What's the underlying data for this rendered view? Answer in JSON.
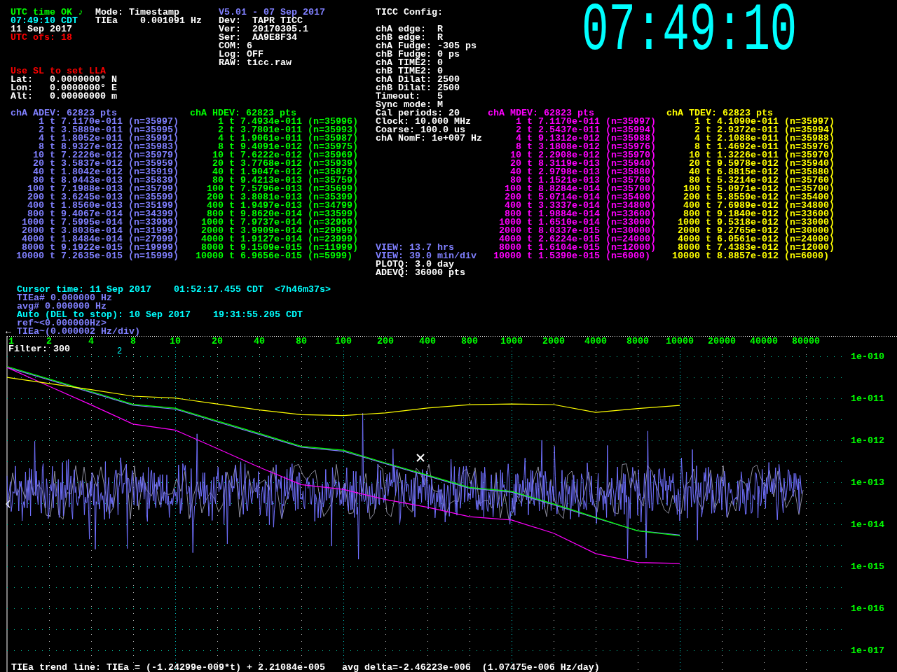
{
  "status": [
    {
      "text": "UTC time OK ♪",
      "color": "#00ff00"
    },
    {
      "text": "07:49:10 CDT",
      "color": "#00ffff"
    },
    {
      "text": "11 Sep 2017",
      "color": "#ffffff"
    },
    {
      "text": "UTC ofs: 18",
      "color": "#ff0000"
    }
  ],
  "location": [
    {
      "text": "Use SL to set LLA",
      "color": "#ff0000"
    },
    {
      "text": "Lat:   0.0000000° N",
      "color": "#ffffff"
    },
    {
      "text": "Lon:   0.0000000° E",
      "color": "#ffffff"
    },
    {
      "text": "Alt:   0.00000000 m",
      "color": "#ffffff"
    }
  ],
  "mode": [
    "Mode: Timestamp",
    "TIEa    0.001091 Hz"
  ],
  "device": [
    {
      "text": "V5.01 - 07 Sep 2017",
      "color": "#8080ff"
    },
    {
      "text": "Dev:  TAPR TICC",
      "color": "#ffffff"
    },
    {
      "text": "Ver:  20170305.1",
      "color": "#ffffff"
    },
    {
      "text": "Ser:  AA9E8F34",
      "color": "#ffffff"
    },
    {
      "text": "COM: 6",
      "color": "#ffffff"
    },
    {
      "text": "Log: OFF",
      "color": "#ffffff"
    },
    {
      "text": "RAW: ticc.raw",
      "color": "#ffffff"
    }
  ],
  "config": {
    "title": "TICC Config:",
    "lines": [
      "chA edge:  R",
      "chB edge:  R",
      "chA Fudge: -305 ps",
      "chB Fudge: 0 ps",
      "chA TIME2: 0",
      "chB TIME2: 0",
      "chA Dilat: 2500",
      "chB Dilat: 2500",
      "Timeout:   5",
      "Sync mode: M",
      "Cal periods: 20",
      "Clock: 10.000 MHz",
      "Coarse: 100.0 us",
      "chA NomF: 1e+007 Hz"
    ]
  },
  "view": [
    {
      "text": "VIEW: 13.7 hrs",
      "color": "#8080ff"
    },
    {
      "text": "VIEW: 39.0 min/div",
      "color": "#8080ff"
    },
    {
      "text": "PLOTQ: 3.0 day",
      "color": "#ffffff"
    },
    {
      "text": "ADEVQ: 36000 pts",
      "color": "#ffffff"
    }
  ],
  "clock": "07:49:10",
  "tables": [
    {
      "title": "chA ADEV: 62823 pts",
      "color": "#8080ff",
      "rows": [
        {
          "tau": "1",
          "symbol": "t",
          "dev": "7.1170e-011",
          "n": "(n=35997)"
        },
        {
          "tau": "2",
          "symbol": "t",
          "dev": "3.5889e-011",
          "n": "(n=35995)"
        },
        {
          "tau": "4",
          "symbol": "t",
          "dev": "1.8052e-011",
          "n": "(n=35991)"
        },
        {
          "tau": "8",
          "symbol": "t",
          "dev": "8.9327e-012",
          "n": "(n=35983)"
        },
        {
          "tau": "10",
          "symbol": "t",
          "dev": "7.2226e-012",
          "n": "(n=35979)"
        },
        {
          "tau": "20",
          "symbol": "t",
          "dev": "3.5837e-012",
          "n": "(n=35959)"
        },
        {
          "tau": "40",
          "symbol": "t",
          "dev": "1.8042e-012",
          "n": "(n=35919)"
        },
        {
          "tau": "80",
          "symbol": "t",
          "dev": "8.9443e-013",
          "n": "(n=35839)"
        },
        {
          "tau": "100",
          "symbol": "t",
          "dev": "7.1988e-013",
          "n": "(n=35799)"
        },
        {
          "tau": "200",
          "symbol": "t",
          "dev": "3.6245e-013",
          "n": "(n=35599)"
        },
        {
          "tau": "400",
          "symbol": "t",
          "dev": "1.8560e-013",
          "n": "(n=35199)"
        },
        {
          "tau": "800",
          "symbol": "t",
          "dev": "9.4067e-014",
          "n": "(n=34399)"
        },
        {
          "tau": "1000",
          "symbol": "t",
          "dev": "7.5995e-014",
          "n": "(n=33999)"
        },
        {
          "tau": "2000",
          "symbol": "t",
          "dev": "3.8036e-014",
          "n": "(n=31999)"
        },
        {
          "tau": "4000",
          "symbol": "t",
          "dev": "1.8484e-014",
          "n": "(n=27999)"
        },
        {
          "tau": "8000",
          "symbol": "t",
          "dev": "9.1922e-015",
          "n": "(n=19999)"
        },
        {
          "tau": "10000",
          "symbol": "t",
          "dev": "7.2635e-015",
          "n": "(n=15999)"
        }
      ]
    },
    {
      "title": "chA HDEV: 62823 pts",
      "color": "#00ff00",
      "rows": [
        {
          "tau": "1",
          "symbol": "t",
          "dev": "7.4934e-011",
          "n": "(n=35996)"
        },
        {
          "tau": "2",
          "symbol": "t",
          "dev": "3.7801e-011",
          "n": "(n=35993)"
        },
        {
          "tau": "4",
          "symbol": "t",
          "dev": "1.9061e-011",
          "n": "(n=35987)"
        },
        {
          "tau": "8",
          "symbol": "t",
          "dev": "9.4091e-012",
          "n": "(n=35975)"
        },
        {
          "tau": "10",
          "symbol": "t",
          "dev": "7.6222e-012",
          "n": "(n=35969)"
        },
        {
          "tau": "20",
          "symbol": "t",
          "dev": "3.7768e-012",
          "n": "(n=35939)"
        },
        {
          "tau": "40",
          "symbol": "t",
          "dev": "1.9047e-012",
          "n": "(n=35879)"
        },
        {
          "tau": "80",
          "symbol": "t",
          "dev": "9.4213e-013",
          "n": "(n=35759)"
        },
        {
          "tau": "100",
          "symbol": "t",
          "dev": "7.5796e-013",
          "n": "(n=35699)"
        },
        {
          "tau": "200",
          "symbol": "t",
          "dev": "3.8081e-013",
          "n": "(n=35399)"
        },
        {
          "tau": "400",
          "symbol": "t",
          "dev": "1.9497e-013",
          "n": "(n=34799)"
        },
        {
          "tau": "800",
          "symbol": "t",
          "dev": "9.8620e-014",
          "n": "(n=33599)"
        },
        {
          "tau": "1000",
          "symbol": "t",
          "dev": "7.9737e-014",
          "n": "(n=32999)"
        },
        {
          "tau": "2000",
          "symbol": "t",
          "dev": "3.9909e-014",
          "n": "(n=29999)"
        },
        {
          "tau": "4000",
          "symbol": "t",
          "dev": "1.9127e-014",
          "n": "(n=23999)"
        },
        {
          "tau": "8000",
          "symbol": "t",
          "dev": "9.1509e-015",
          "n": "(n=11999)"
        },
        {
          "tau": "10000",
          "symbol": "t",
          "dev": "6.9656e-015",
          "n": "(n=5999)"
        }
      ]
    },
    {
      "title": "chA MDEV: 62823 pts",
      "color": "#ff00ff",
      "rows": [
        {
          "tau": "1",
          "symbol": "t",
          "dev": "7.1170e-011",
          "n": "(n=35997)"
        },
        {
          "tau": "2",
          "symbol": "t",
          "dev": "2.5437e-011",
          "n": "(n=35994)"
        },
        {
          "tau": "4",
          "symbol": "t",
          "dev": "9.1312e-012",
          "n": "(n=35988)"
        },
        {
          "tau": "8",
          "symbol": "t",
          "dev": "3.1808e-012",
          "n": "(n=35976)"
        },
        {
          "tau": "10",
          "symbol": "t",
          "dev": "2.2908e-012",
          "n": "(n=35970)"
        },
        {
          "tau": "20",
          "symbol": "t",
          "dev": "8.3119e-013",
          "n": "(n=35940)"
        },
        {
          "tau": "40",
          "symbol": "t",
          "dev": "2.9798e-013",
          "n": "(n=35880)"
        },
        {
          "tau": "80",
          "symbol": "t",
          "dev": "1.1521e-013",
          "n": "(n=35760)"
        },
        {
          "tau": "100",
          "symbol": "t",
          "dev": "8.8284e-014",
          "n": "(n=35700)"
        },
        {
          "tau": "200",
          "symbol": "t",
          "dev": "5.0714e-014",
          "n": "(n=35400)"
        },
        {
          "tau": "400",
          "symbol": "t",
          "dev": "3.3337e-014",
          "n": "(n=34800)"
        },
        {
          "tau": "800",
          "symbol": "t",
          "dev": "1.9884e-014",
          "n": "(n=33600)"
        },
        {
          "tau": "1000",
          "symbol": "t",
          "dev": "1.6510e-014",
          "n": "(n=33000)"
        },
        {
          "tau": "2000",
          "symbol": "t",
          "dev": "8.0337e-015",
          "n": "(n=30000)"
        },
        {
          "tau": "4000",
          "symbol": "t",
          "dev": "2.6224e-015",
          "n": "(n=24000)"
        },
        {
          "tau": "8000",
          "symbol": "t",
          "dev": "1.6104e-015",
          "n": "(n=12000)"
        },
        {
          "tau": "10000",
          "symbol": "t",
          "dev": "1.5390e-015",
          "n": "(n=6000)"
        }
      ]
    },
    {
      "title": "chA TDEV: 62823 pts",
      "color": "#ffff00",
      "rows": [
        {
          "tau": "1",
          "symbol": "t",
          "dev": "4.1090e-011",
          "n": "(n=35997)"
        },
        {
          "tau": "2",
          "symbol": "t",
          "dev": "2.9372e-011",
          "n": "(n=35994)"
        },
        {
          "tau": "4",
          "symbol": "t",
          "dev": "2.1088e-011",
          "n": "(n=35988)"
        },
        {
          "tau": "8",
          "symbol": "t",
          "dev": "1.4692e-011",
          "n": "(n=35976)"
        },
        {
          "tau": "10",
          "symbol": "t",
          "dev": "1.3226e-011",
          "n": "(n=35970)"
        },
        {
          "tau": "20",
          "symbol": "t",
          "dev": "9.5978e-012",
          "n": "(n=35940)"
        },
        {
          "tau": "40",
          "symbol": "t",
          "dev": "6.8815e-012",
          "n": "(n=35880)"
        },
        {
          "tau": "80",
          "symbol": "t",
          "dev": "5.3214e-012",
          "n": "(n=35760)"
        },
        {
          "tau": "100",
          "symbol": "t",
          "dev": "5.0971e-012",
          "n": "(n=35700)"
        },
        {
          "tau": "200",
          "symbol": "t",
          "dev": "5.8559e-012",
          "n": "(n=35400)"
        },
        {
          "tau": "400",
          "symbol": "t",
          "dev": "7.6989e-012",
          "n": "(n=34800)"
        },
        {
          "tau": "800",
          "symbol": "t",
          "dev": "9.1840e-012",
          "n": "(n=33600)"
        },
        {
          "tau": "1000",
          "symbol": "t",
          "dev": "9.5318e-012",
          "n": "(n=33000)"
        },
        {
          "tau": "2000",
          "symbol": "t",
          "dev": "9.2765e-012",
          "n": "(n=30000)"
        },
        {
          "tau": "4000",
          "symbol": "t",
          "dev": "6.0561e-012",
          "n": "(n=24000)"
        },
        {
          "tau": "8000",
          "symbol": "t",
          "dev": "7.4383e-012",
          "n": "(n=12000)"
        },
        {
          "tau": "10000",
          "symbol": "t",
          "dev": "8.8857e-012",
          "n": "(n=6000)"
        }
      ]
    }
  ],
  "cursor": {
    "lines": [
      {
        "text": "Cursor time: 11 Sep 2017    01:52:17.455 CDT  <7h46m37s>",
        "color": "#00ffff"
      },
      {
        "text": "TIEa# 0.000000 Hz",
        "color": "#8080ff"
      },
      {
        "text": "avg# 0.000000 Hz",
        "color": "#8080ff"
      },
      {
        "text": "Auto (DEL to stop): 10 Sep 2017    19:31:55.205 CDT",
        "color": "#00ffff"
      },
      {
        "text": "ref~<0.000000Hz>",
        "color": "#8080ff"
      }
    ],
    "arrow": "←",
    "scale": {
      "text": "TIEa~(0.000002 Hz/div)",
      "color": "#8080ff"
    }
  },
  "plot": {
    "tau_labels": [
      "1",
      "2",
      "4",
      "8",
      "10",
      "20",
      "40",
      "80",
      "100",
      "200",
      "400",
      "800",
      "1000",
      "2000",
      "4000",
      "8000",
      "10000",
      "20000",
      "40000",
      "80000"
    ],
    "filter": "Filter: 300",
    "marker_label": "2",
    "decade_labels": [
      "1e-010",
      "1e-011",
      "1e-012",
      "1e-013",
      "1e-014",
      "1e-015",
      "1e-016",
      "1e-017"
    ],
    "trend": "TIEa trend line: TIEa = (-1.24299e-009*t) + 2.21084e-005   avg delta=-2.46223e-006  (1.07475e-006 Hz/day)"
  }
}
